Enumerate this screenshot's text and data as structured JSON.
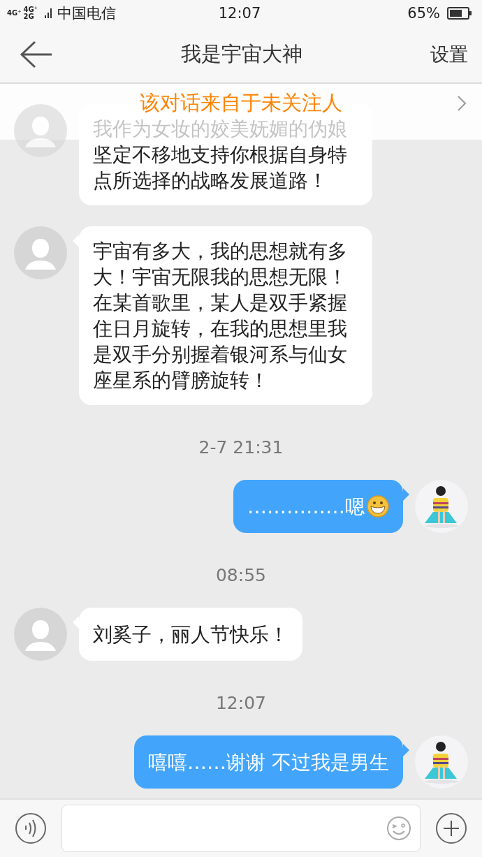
{
  "status_bar": {
    "network": [
      "4G⁺",
      "4G⁺ 2G"
    ],
    "carrier": "中国电信",
    "time": "12:07",
    "battery": "65%"
  },
  "header": {
    "title": "我是宇宙大神",
    "action": "设置"
  },
  "banner": {
    "text": "该对话来自于未关注人"
  },
  "messages": [
    {
      "kind": "incoming",
      "faded_text": "我作为女妆的姣美妩媚的伪娘",
      "text": "坚定不移地支持你根据自身特点所选择的战略发展道路！"
    },
    {
      "kind": "incoming",
      "text": "宇宙有多大，我的思想就有多大！宇宙无限我的思想无限！在某首歌里，某人是双手紧握住日月旋转，在我的思想里我是双手分别握着银河系与仙女座星系的臂膀旋转！"
    },
    {
      "kind": "time",
      "text": "2-7 21:31"
    },
    {
      "kind": "outgoing",
      "text": "……………嗯",
      "emoji": true
    },
    {
      "kind": "time",
      "text": "08:55"
    },
    {
      "kind": "incoming",
      "text": "刘奚子，丽人节快乐！"
    },
    {
      "kind": "time",
      "text": "12:07"
    },
    {
      "kind": "outgoing",
      "text": "嘻嘻……谢谢 不过我是男生"
    }
  ]
}
